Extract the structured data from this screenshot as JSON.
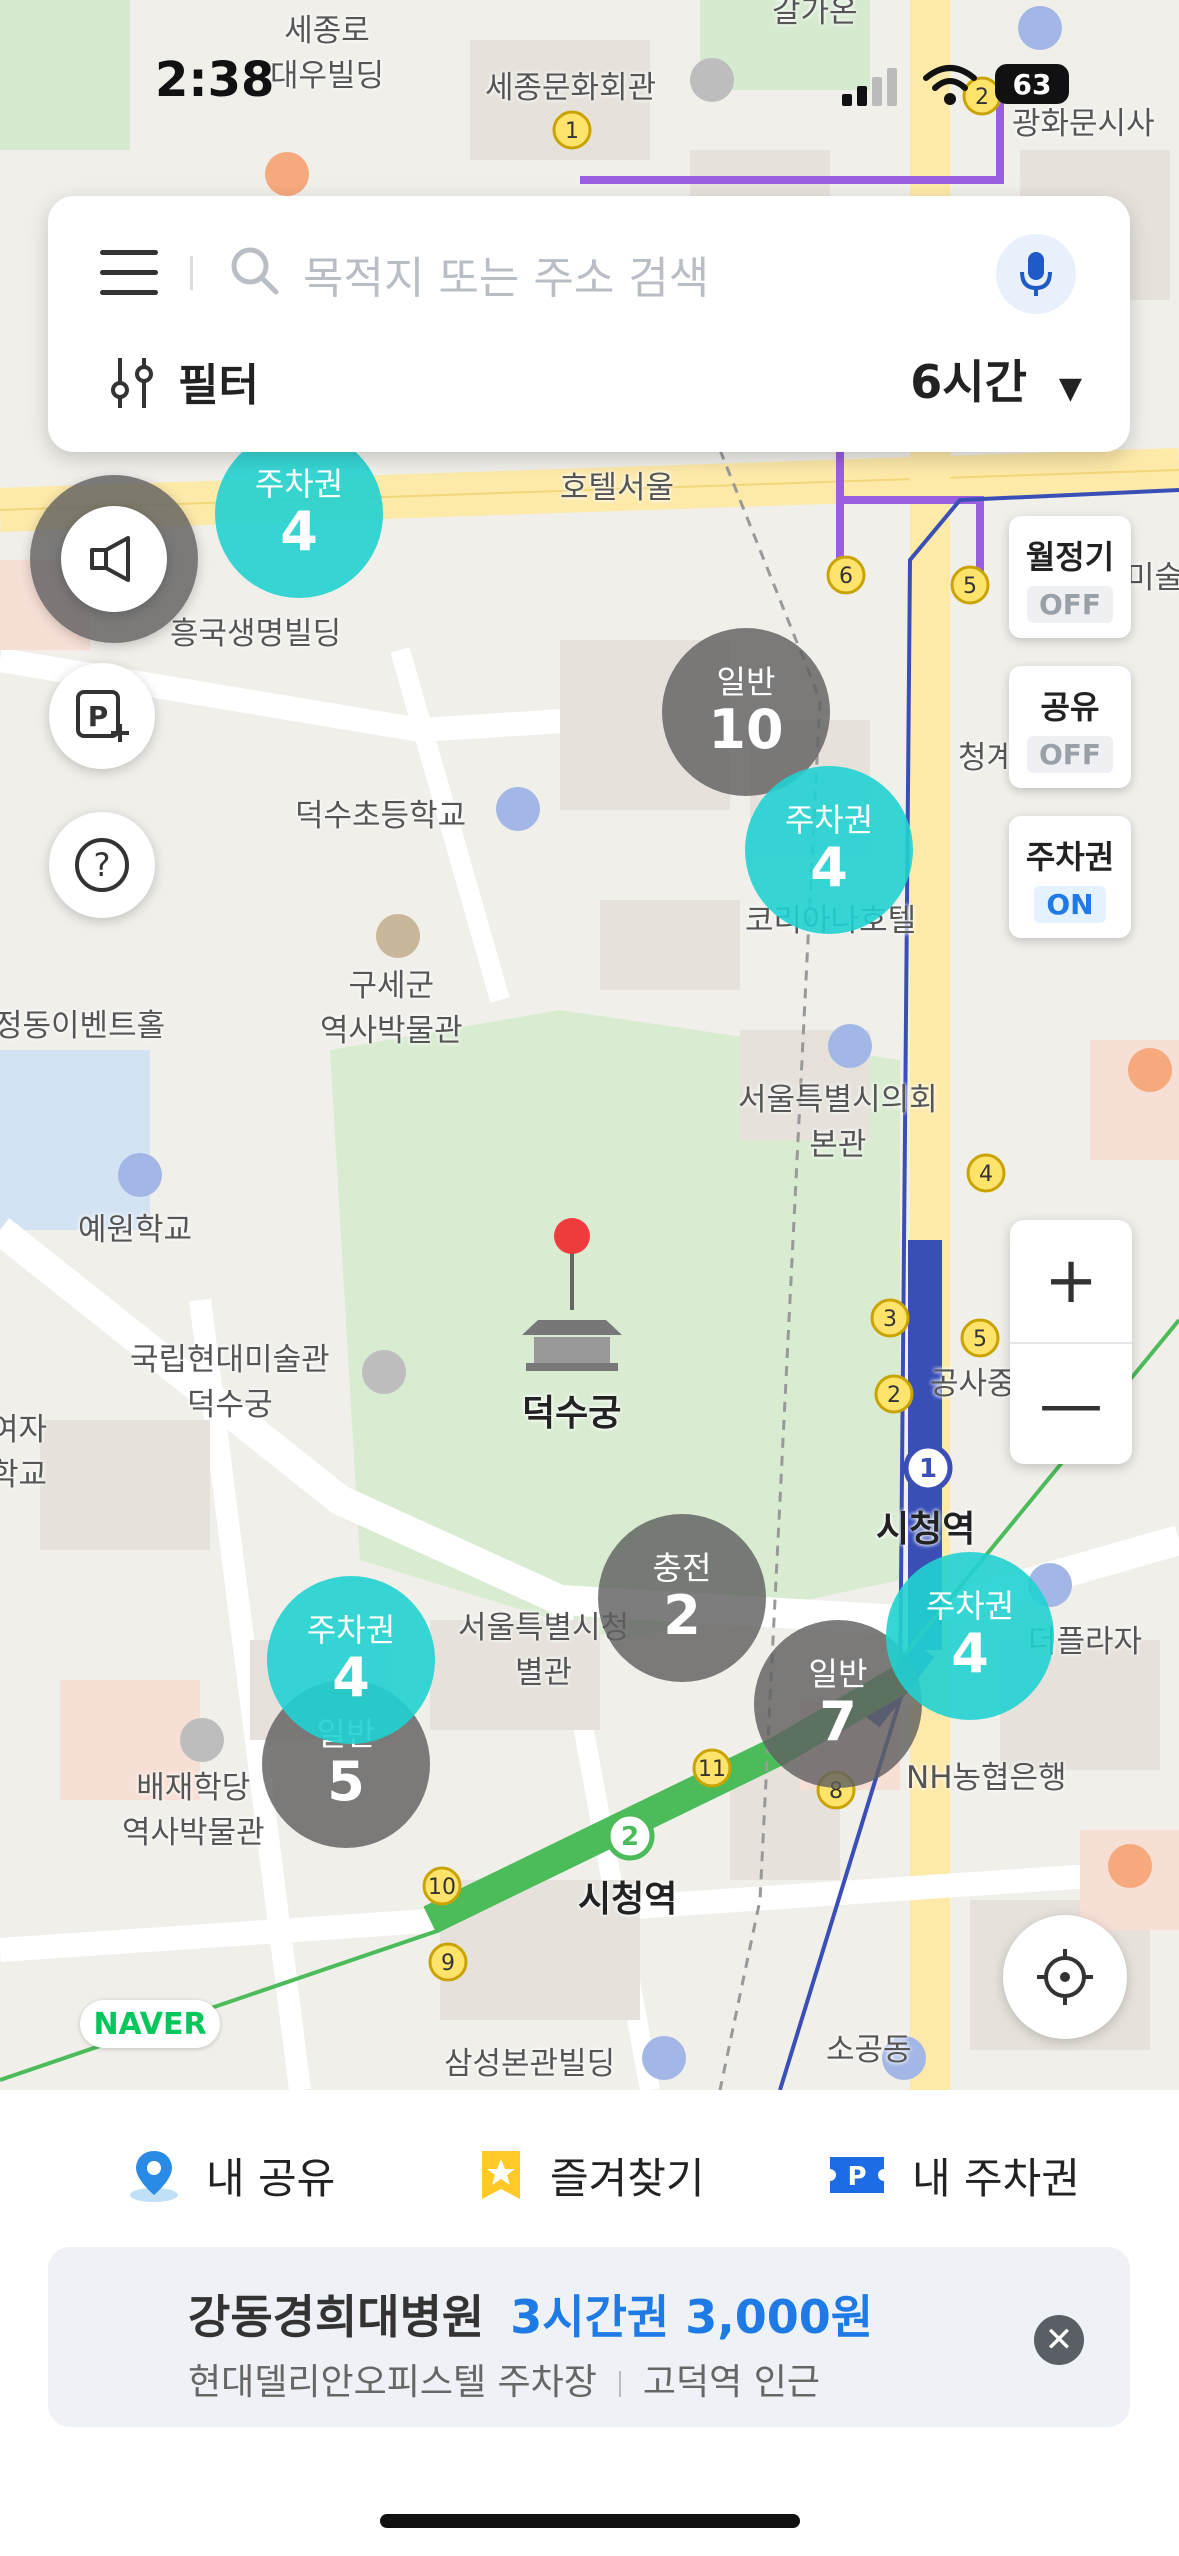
{
  "status_bar": {
    "time": "2:38",
    "battery": "63"
  },
  "search": {
    "placeholder": "목적지 또는 주소 검색",
    "filter_label": "필터",
    "time_select": "6시간"
  },
  "map": {
    "labels": [
      "세종로\n대우빌딩",
      "세종문화회관",
      "갈가온",
      "광화문시사",
      "호텔서울",
      "흥국생명빌딩",
      "덕수초등학교",
      "코리아나호텔",
      "구세군\n역사박물관",
      "정동이벤트홀",
      "서울특별시의회\n본관",
      "예원학교",
      "국립현대미술관\n덕수궁",
      "덕수궁",
      "시청역",
      "서울특별시청\n별관",
      "배재학당\n역사박물관",
      "시청역",
      "NH농협은행",
      "더플라자",
      "삼성본관빌딩",
      "소공동",
      "여자\n학교",
      "공사중",
      "청계",
      "미술"
    ],
    "bubbles": [
      {
        "label": "주차권",
        "count": "4",
        "kind": "ticket"
      },
      {
        "label": "일반",
        "count": "10",
        "kind": "general"
      },
      {
        "label": "주차권",
        "count": "4",
        "kind": "ticket"
      },
      {
        "label": "충전",
        "count": "2",
        "kind": "general"
      },
      {
        "label": "주차권",
        "count": "4",
        "kind": "ticket"
      },
      {
        "label": "일반",
        "count": "5",
        "kind": "general"
      },
      {
        "label": "일반",
        "count": "7",
        "kind": "general"
      },
      {
        "label": "주차권",
        "count": "4",
        "kind": "ticket"
      }
    ],
    "toggles": [
      {
        "label": "월정기",
        "state": "OFF"
      },
      {
        "label": "공유",
        "state": "OFF"
      },
      {
        "label": "주차권",
        "state": "ON"
      }
    ],
    "zoom_in": "+",
    "zoom_out": "—",
    "naver_logo": "NAVER"
  },
  "tabs": [
    {
      "label": "내 공유",
      "icon": "location-pin-icon"
    },
    {
      "label": "즐겨찾기",
      "icon": "star-icon"
    },
    {
      "label": "내 주차권",
      "icon": "parking-ticket-icon"
    }
  ],
  "card": {
    "title": "강동경희대병원",
    "price": "3시간권 3,000원",
    "lot": "현대델리안오피스텔 주차장",
    "near": "고덕역 인근"
  },
  "colors": {
    "accent": "#1e7be6",
    "ticket": "#21d2d2",
    "general": "#606060"
  }
}
